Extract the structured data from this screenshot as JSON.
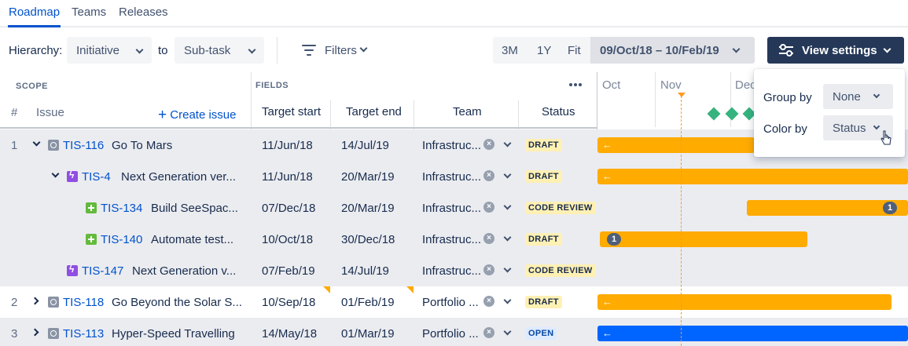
{
  "tabs": [
    {
      "label": "Roadmap",
      "active": true
    },
    {
      "label": "Teams",
      "active": false
    },
    {
      "label": "Releases",
      "active": false
    }
  ],
  "toolbar": {
    "hierarchy_label": "Hierarchy:",
    "hierarchy_from": "Initiative",
    "to_label": "to",
    "hierarchy_to": "Sub-task",
    "filters_label": "Filters",
    "range_3m": "3M",
    "range_1y": "1Y",
    "range_fit": "Fit",
    "date_range": "09/Oct/18 – 10/Feb/19",
    "view_settings_label": "View settings"
  },
  "grid": {
    "scope_label": "SCOPE",
    "fields_label": "FIELDS",
    "num_header": "#",
    "issue_header": "Issue",
    "create_issue_label": "Create issue",
    "target_start_header": "Target start",
    "target_end_header": "Target end",
    "team_header": "Team",
    "status_header": "Status"
  },
  "timeline": {
    "months": [
      "Oct",
      "Nov",
      "Dec"
    ]
  },
  "rows": [
    {
      "num": "1",
      "key": "TIS-116",
      "title": "Go To Mars",
      "type": "initiative",
      "start": "11/Jun/18",
      "end": "14/Jul/19",
      "team": "Infrastruc...",
      "status": "DRAFT"
    },
    {
      "num": "",
      "key": "TIS-4",
      "title": "Next Generation ver...",
      "type": "epic",
      "start": "11/Jun/18",
      "end": "20/Mar/19",
      "team": "Infrastruc...",
      "status": "DRAFT"
    },
    {
      "num": "",
      "key": "TIS-134",
      "title": "Build SeeSpac...",
      "type": "story",
      "start": "07/Dec/18",
      "end": "20/Mar/19",
      "team": "Infrastruc...",
      "status": "CODE REVIEW",
      "badge": "1"
    },
    {
      "num": "",
      "key": "TIS-140",
      "title": "Automate test...",
      "type": "story",
      "start": "10/Oct/18",
      "end": "30/Dec/18",
      "team": "Infrastruc...",
      "status": "DRAFT",
      "badge": "1"
    },
    {
      "num": "",
      "key": "TIS-147",
      "title": "Next Generation v...",
      "type": "epic",
      "start": "07/Feb/19",
      "end": "14/Jul/19",
      "team": "Infrastruc...",
      "status": "CODE REVIEW"
    },
    {
      "num": "2",
      "key": "TIS-118",
      "title": "Go Beyond the Solar S...",
      "type": "initiative",
      "start": "10/Sep/18",
      "end": "01/Feb/19",
      "team": "Portfolio ...",
      "status": "DRAFT"
    },
    {
      "num": "3",
      "key": "TIS-113",
      "title": "Hyper-Speed Travelling",
      "type": "initiative",
      "start": "14/May/18",
      "end": "01/Mar/19",
      "team": "Portfolio ...",
      "status": "OPEN"
    }
  ],
  "view_settings_popover": {
    "group_by_label": "Group by",
    "group_by_value": "None",
    "color_by_label": "Color by",
    "color_by_value": "Status"
  },
  "colors": {
    "accent": "#0052cc",
    "bar_orange": "#ffab00",
    "bar_blue": "#0065ff",
    "milestone": "#36b37e",
    "header_dark": "#253858"
  }
}
